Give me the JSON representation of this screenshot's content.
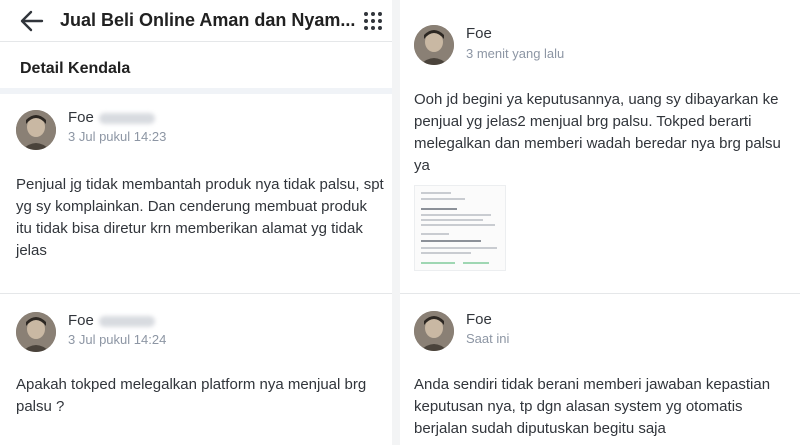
{
  "header": {
    "title": "Jual Beli Online Aman dan Nyam...",
    "back_icon": "arrow-left-icon",
    "menu_icon": "grid-menu-icon"
  },
  "section": {
    "title": "Detail Kendala"
  },
  "left_messages": [
    {
      "name": "Foe",
      "time": "3 Jul pukul 14:23",
      "text": "Penjual jg tidak membantah produk nya tidak palsu, spt yg sy komplainkan. Dan cenderung membuat produk itu tidak bisa diretur krn memberikan alamat yg tidak jelas"
    },
    {
      "name": "Foe",
      "time": "3 Jul pukul 14:24",
      "text": "Apakah tokped melegalkan platform nya menjual brg palsu ?"
    }
  ],
  "right_messages": [
    {
      "name": "Foe",
      "time": "3 menit yang lalu",
      "text": "Ooh jd begini ya keputusannya, uang sy dibayarkan ke penjual yg jelas2 menjual brg palsu. Tokped berarti melegalkan dan memberi wadah beredar nya brg palsu ya"
    },
    {
      "name": "Foe",
      "time": "Saat ini",
      "text": "Anda sendiri tidak berani memberi jawaban kepastian keputusan nya, tp dgn alasan system yg otomatis berjalan sudah diputuskan begitu saja"
    }
  ],
  "colors": {
    "text": "#31353b",
    "muted": "#8d96a4",
    "divider": "#e5e7e9"
  }
}
